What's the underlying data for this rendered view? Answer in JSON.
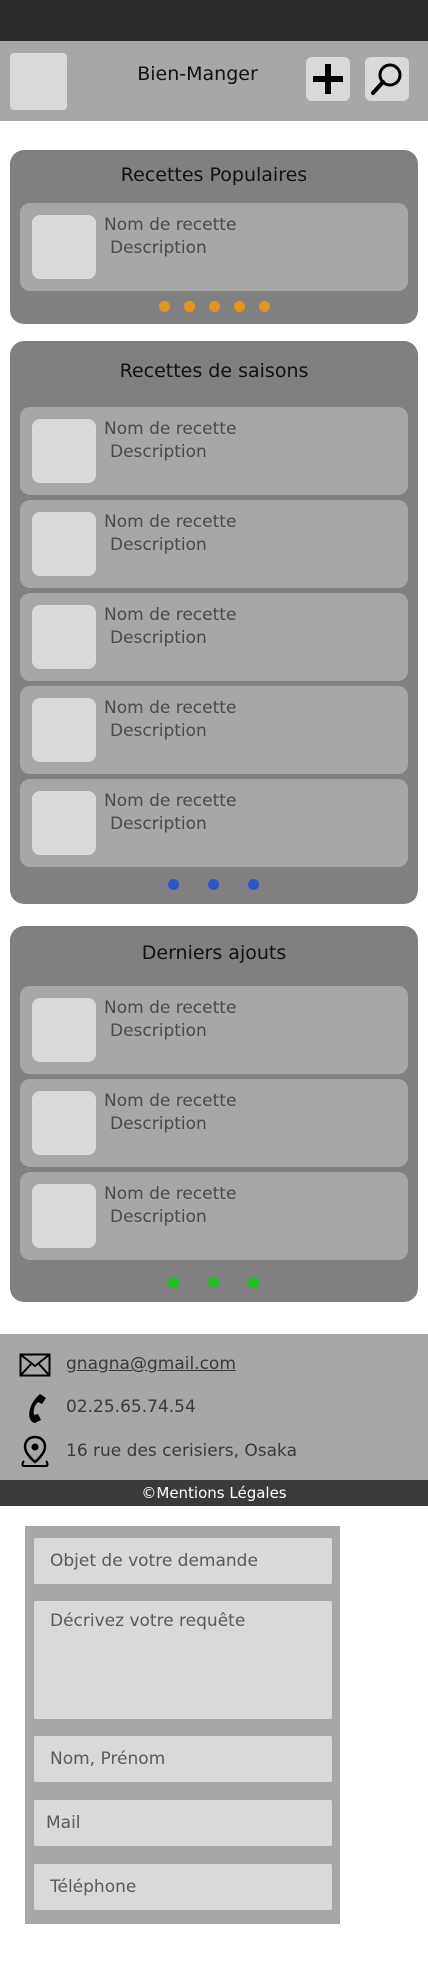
{
  "header": {
    "title": "Bien-Manger"
  },
  "sections": {
    "popular": {
      "title": "Recettes Populaires",
      "dot_color": "#e3951e",
      "items": [
        {
          "name": "Nom de recette",
          "desc": "Description"
        }
      ]
    },
    "seasonal": {
      "title": "Recettes de saisons",
      "dot_color": "#2d55c6",
      "items": [
        {
          "name": "Nom de recette",
          "desc": "Description"
        },
        {
          "name": "Nom de recette",
          "desc": "Description"
        },
        {
          "name": "Nom de recette",
          "desc": "Description"
        },
        {
          "name": "Nom de recette",
          "desc": "Description"
        },
        {
          "name": "Nom de recette",
          "desc": "Description"
        }
      ]
    },
    "latest": {
      "title": "Derniers ajouts",
      "dot_color": "#1fbf1f",
      "items": [
        {
          "name": "Nom de recette",
          "desc": "Description"
        },
        {
          "name": "Nom de recette",
          "desc": "Description"
        },
        {
          "name": "Nom de recette",
          "desc": "Description"
        }
      ]
    }
  },
  "contact": {
    "email": "gnagna@gmail.com",
    "phone": "02.25.65.74.54",
    "address": "16 rue des cerisiers, Osaka",
    "legal": "©Mentions Légales"
  },
  "form": {
    "subject_placeholder": "Objet de votre demande",
    "message_placeholder": "Décrivez votre requête",
    "name_placeholder": "Nom, Prénom",
    "mail_placeholder": "Mail",
    "phone_placeholder": "Téléphone"
  },
  "icons": {
    "logo": "logo-placeholder",
    "add": "plus-icon",
    "search": "search-icon",
    "mail": "mail-icon",
    "phone": "phone-icon",
    "location": "location-pin-icon"
  }
}
